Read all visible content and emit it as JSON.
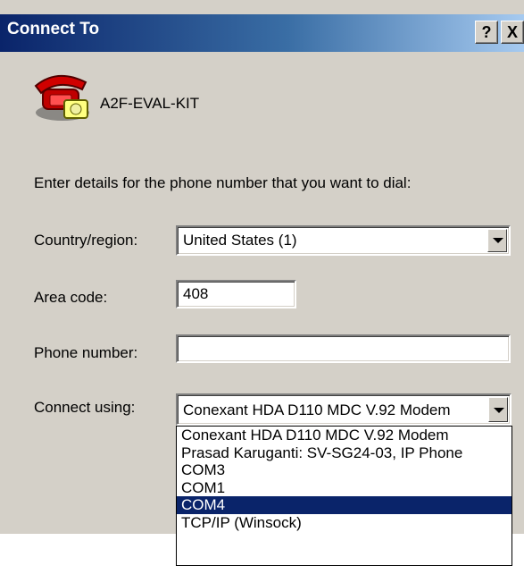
{
  "window": {
    "title": "Connect To",
    "help_button": "?",
    "close_button": "X"
  },
  "connection": {
    "name": "A2F-EVAL-KIT",
    "icon": "telephone-icon"
  },
  "instructions": "Enter details for the phone number that you want to dial:",
  "form": {
    "country_label": "Country/region:",
    "country_value": "United States (1)",
    "area_label": "Area code:",
    "area_value": "408",
    "phone_label": "Phone number:",
    "phone_value": "",
    "connect_label": "Connect using:",
    "connect_value": "Conexant HDA D110 MDC V.92 Modem"
  },
  "connect_options": [
    "Conexant HDA D110 MDC V.92 Modem",
    "Prasad Karuganti: SV-SG24-03, IP Phone",
    "COM3",
    "COM1",
    "COM4",
    "TCP/IP (Winsock)"
  ],
  "selected_option_index": 4,
  "colors": {
    "dialog_bg": "#d4d0c8",
    "title_gradient_start": "#0a246a",
    "title_gradient_end": "#a6caf0",
    "selection_bg": "#0a246a"
  }
}
